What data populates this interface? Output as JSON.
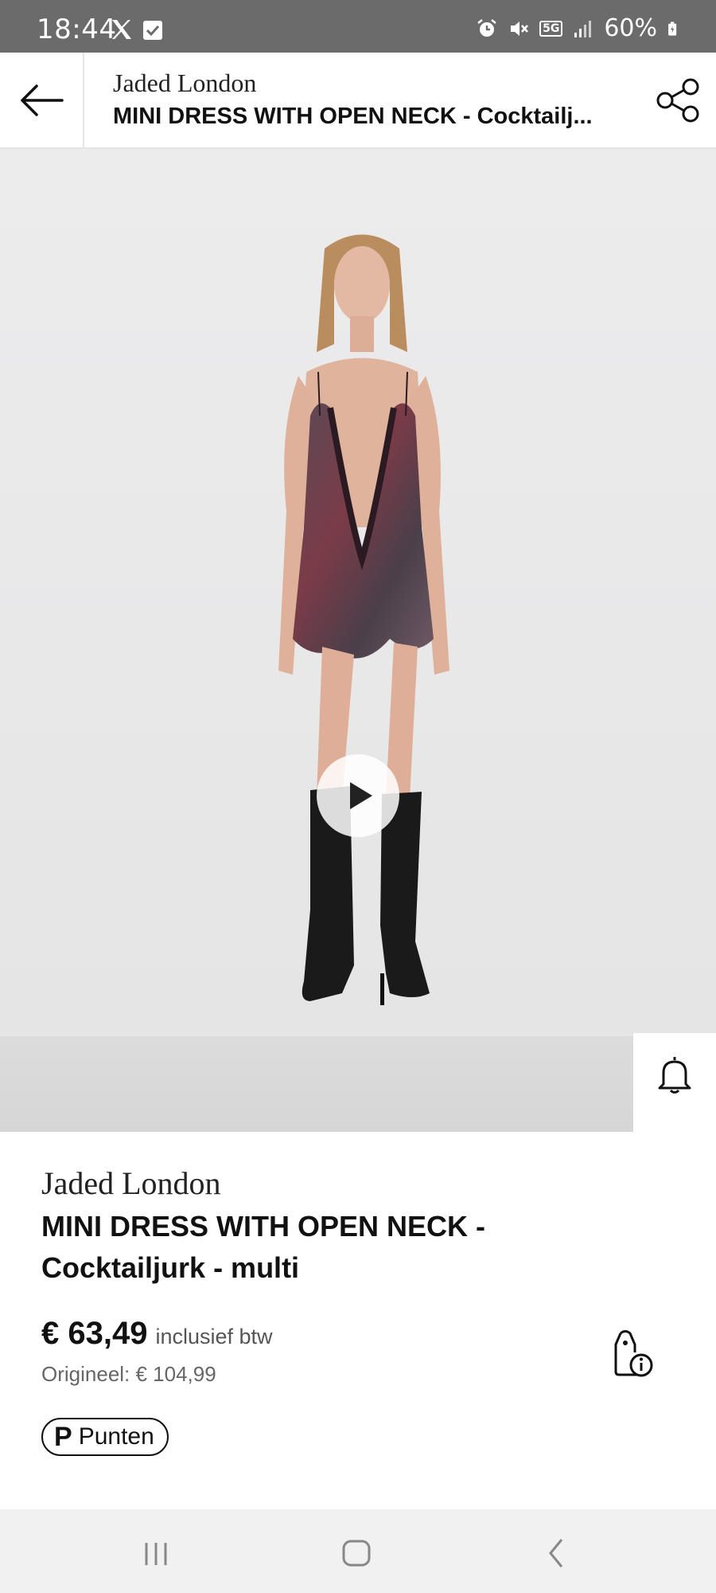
{
  "status_bar": {
    "time": "18:44",
    "battery": "60%",
    "network": "5G",
    "icons": [
      "x-icon",
      "checkbox-icon",
      "alarm-icon",
      "mute-icon",
      "signal-icon",
      "battery-icon"
    ]
  },
  "header": {
    "brand": "Jaded London",
    "title": "MINI DRESS WITH OPEN NECK - Cocktailj...",
    "icons": [
      "back-arrow-icon",
      "share-icon"
    ]
  },
  "media": {
    "video_progress": 0.11,
    "icons": [
      "play-icon",
      "bell-icon",
      "heart-icon",
      "shopping-bag-icon",
      "size-compare-icon"
    ]
  },
  "product": {
    "brand": "Jaded London",
    "title": "MINI DRESS WITH OPEN NECK - Cocktailjurk - multi",
    "price": "€ 63,49",
    "vat_note": "inclusief btw",
    "original_price": "Origineel: € 104,99",
    "points_label": "Punten",
    "points_symbol": "P",
    "icons": [
      "price-info-tag-icon"
    ]
  },
  "colors": {
    "status_bar_bg": "#6b6b6b",
    "accent_dark": "#111111",
    "nav_bar_bg": "#f1f1f1"
  }
}
